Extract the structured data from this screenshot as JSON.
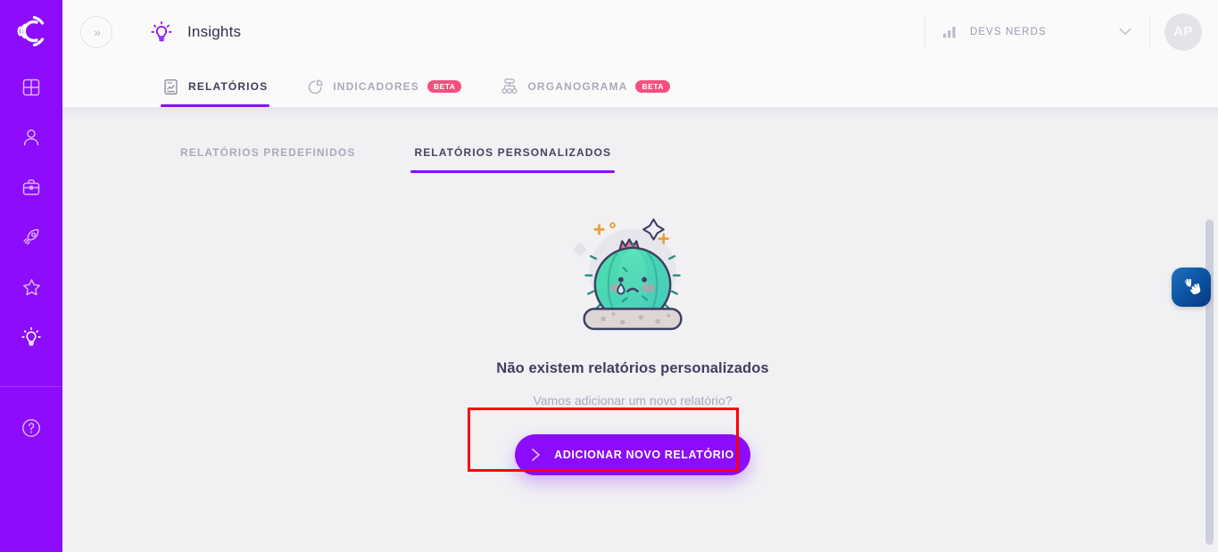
{
  "sidebar": {
    "logo_alt": "concilie-logo",
    "items": [
      {
        "name": "dashboard",
        "icon": "grid-icon",
        "active": false
      },
      {
        "name": "people",
        "icon": "user-icon",
        "active": false
      },
      {
        "name": "jobs",
        "icon": "briefcase-icon",
        "active": false
      },
      {
        "name": "launch",
        "icon": "rocket-icon",
        "active": false
      },
      {
        "name": "favorites",
        "icon": "star-icon",
        "active": false
      },
      {
        "name": "insights",
        "icon": "lightbulb-icon",
        "active": true
      }
    ],
    "help": {
      "name": "help",
      "icon": "question-circle-icon"
    }
  },
  "header": {
    "collapse_icon": "chevron-double-right-icon",
    "collapse_label": "»",
    "page_icon": "lightbulb-icon",
    "title": "Insights",
    "org_icon": "bar-chart-icon",
    "org_name": "DEVS NERDS",
    "org_caret_icon": "chevron-down-icon",
    "avatar_initials": "AP"
  },
  "main_tabs": [
    {
      "label": "RELATÓRIOS",
      "icon": "report-document-icon",
      "active": true,
      "badge": ""
    },
    {
      "label": "INDICADORES",
      "icon": "pie-chart-icon",
      "active": false,
      "badge": "BETA"
    },
    {
      "label": "ORGANOGRAMA",
      "icon": "org-chart-icon",
      "active": false,
      "badge": "BETA"
    }
  ],
  "sub_tabs": [
    {
      "label": "RELATÓRIOS PREDEFINIDOS",
      "active": false
    },
    {
      "label": "RELATÓRIOS PERSONALIZADOS",
      "active": true
    }
  ],
  "empty_state": {
    "illustration": "sad-cactus-illustration",
    "title": "Não existem relatórios personalizados",
    "subtitle": "Vamos adicionar um novo relatório?",
    "cta_label": "ADICIONAR NOVO RELATÓRIO",
    "cta_icon": "chevron-right-icon"
  },
  "widgets": {
    "accessibility_icon": "sign-language-hands-icon",
    "scrollbar": "vertical-scrollbar"
  },
  "colors": {
    "brand_purple": "#8c0cfb",
    "beta_pink": "#f84f7e",
    "annotation_red": "#fe0000",
    "header_bg": "#fafafa",
    "content_bg": "#f1f1f4",
    "text_dark": "#3e3f5e",
    "text_muted": "#a9a9bb",
    "a11y_blue": "#0b4fa0"
  }
}
